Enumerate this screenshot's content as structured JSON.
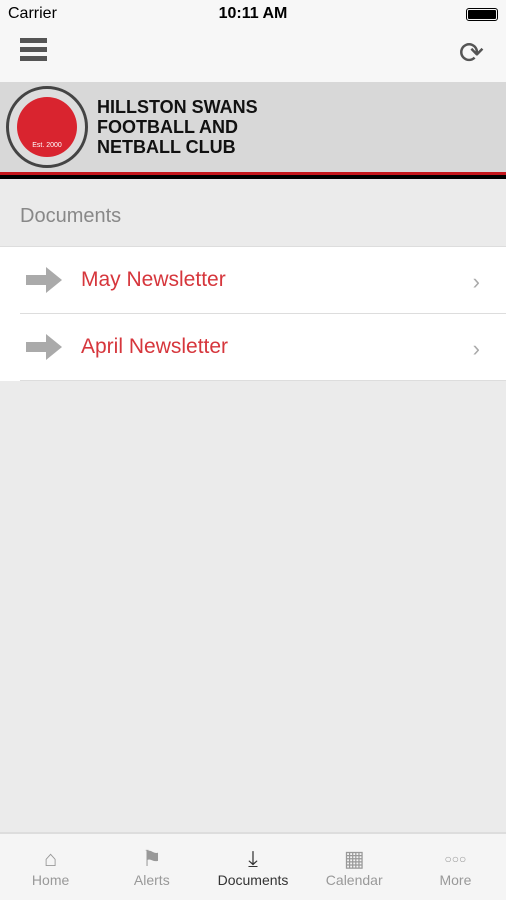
{
  "status": {
    "carrier": "Carrier",
    "time": "10:11 AM"
  },
  "header": {
    "club_name": [
      "HILLSTON SWANS",
      "FOOTBALL AND",
      "NETBALL CLUB"
    ],
    "logo_text": "Est. 2000"
  },
  "section_title": "Documents",
  "documents": [
    {
      "label": "May Newsletter"
    },
    {
      "label": "April Newsletter"
    }
  ],
  "tabs": [
    {
      "label": "Home",
      "icon": "home-icon"
    },
    {
      "label": "Alerts",
      "icon": "flag-icon"
    },
    {
      "label": "Documents",
      "icon": "inbox-download-icon",
      "active": true
    },
    {
      "label": "Calendar",
      "icon": "calendar-icon"
    },
    {
      "label": "More",
      "icon": "more-icon"
    }
  ],
  "colors": {
    "accent": "#d6363c",
    "stripe_red": "#c4161c"
  }
}
